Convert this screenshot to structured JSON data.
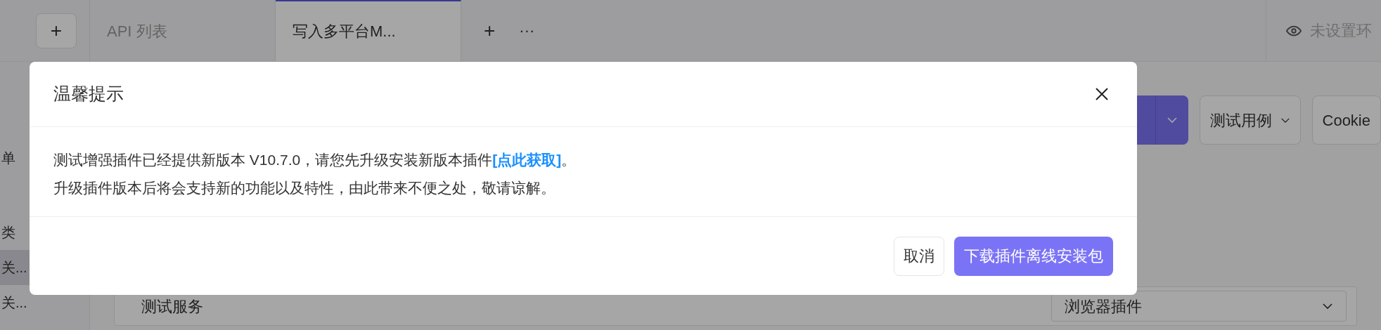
{
  "sidebar": {
    "add_button": "+",
    "items": [
      {
        "label": "单",
        "selected": false
      },
      {
        "label": "类",
        "selected": false
      },
      {
        "label": "关...",
        "selected": true
      },
      {
        "label": "关...",
        "selected": false
      }
    ]
  },
  "tabs": [
    {
      "label": "API 列表",
      "selected": false
    },
    {
      "label": "写入多平台M...",
      "selected": true
    }
  ],
  "tab_actions": {
    "add": "+",
    "more": "···"
  },
  "environment": {
    "label": "未设置环"
  },
  "toolbar": {
    "dropdowns": [
      {
        "label": "测试用例",
        "caret": true
      },
      {
        "label": "Cookie",
        "caret": false
      }
    ]
  },
  "form": {
    "service": "测试服务",
    "plugin_select": "浏览器插件"
  },
  "dialog": {
    "title": "温馨提示",
    "line_1": "测试增强插件已经提供新版本 V10.7.0，请您先升级安装新版本插件",
    "link": "[点此获取]",
    "line_1_end": "。",
    "line_2": "升级插件版本后将会支持新的功能以及特性，由此带来不便之处，敬请谅解。",
    "buttons": [
      {
        "label": "取消",
        "kind": "default"
      },
      {
        "label": "下载插件离线安装包",
        "kind": "primary"
      }
    ]
  }
}
